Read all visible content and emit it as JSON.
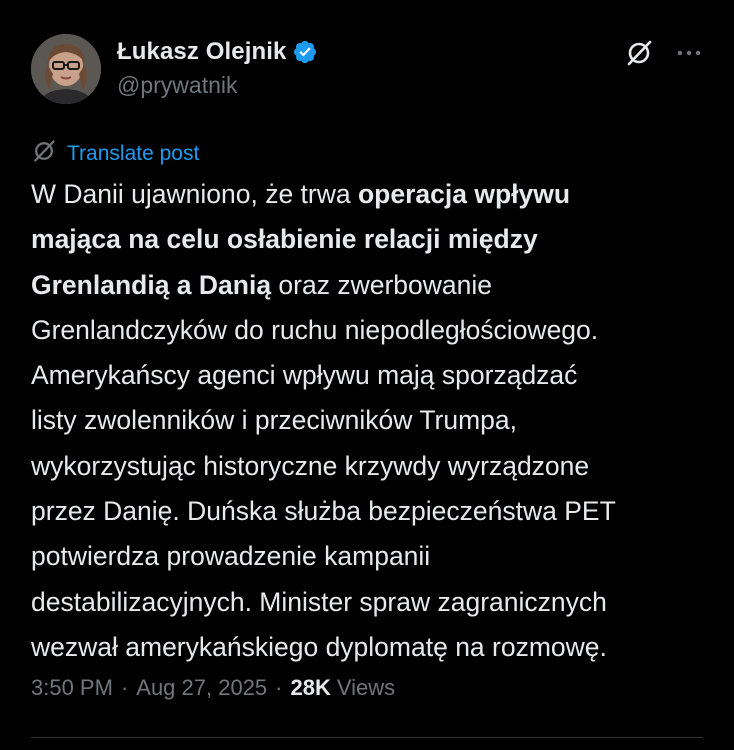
{
  "author": {
    "display_name": "Łukasz Olejnik",
    "handle": "@prywatnik",
    "verified": true
  },
  "icons": {
    "verified": "verified-badge-icon",
    "grok": "grok-icon",
    "more": "more-dots-icon",
    "translate": "translate-icon"
  },
  "colors": {
    "background": "#000000",
    "text": "#e7e9ea",
    "muted": "#71767b",
    "accent": "#1d9bf0"
  },
  "translate_label": "Translate post",
  "post": {
    "lines": [
      {
        "segments": [
          {
            "text": "W Danii ujawniono, że trwa ",
            "bold": false
          },
          {
            "text": "operacja wpływu",
            "bold": true
          }
        ]
      },
      {
        "segments": [
          {
            "text": "mająca na celu osłabienie relacji między",
            "bold": true
          }
        ]
      },
      {
        "segments": [
          {
            "text": "Grenlandią a Danią",
            "bold": true
          },
          {
            "text": " oraz zwerbowanie",
            "bold": false
          }
        ]
      },
      {
        "segments": [
          {
            "text": "Grenlandczyków do ruchu niepodległościowego.",
            "bold": false
          }
        ]
      },
      {
        "segments": [
          {
            "text": "Amerykańscy agenci wpływu mają sporządzać",
            "bold": false
          }
        ]
      },
      {
        "segments": [
          {
            "text": "listy zwolenników i przeciwników Trumpa,",
            "bold": false
          }
        ]
      },
      {
        "segments": [
          {
            "text": "wykorzystując historyczne krzywdy wyrządzone",
            "bold": false
          }
        ]
      },
      {
        "segments": [
          {
            "text": "przez Danię. Duńska służba bezpieczeństwa PET",
            "bold": false
          }
        ]
      },
      {
        "segments": [
          {
            "text": "potwierdza prowadzenie kampanii",
            "bold": false
          }
        ]
      },
      {
        "segments": [
          {
            "text": "destabilizacyjnych. Minister spraw zagranicznych",
            "bold": false
          }
        ]
      },
      {
        "segments": [
          {
            "text": "wezwał amerykańskiego dyplomatę na rozmowę.",
            "bold": false
          }
        ]
      }
    ]
  },
  "meta": {
    "time": "3:50 PM",
    "date": "Aug 27, 2025",
    "views_count": "28K",
    "views_label": "Views",
    "separator": "·"
  }
}
